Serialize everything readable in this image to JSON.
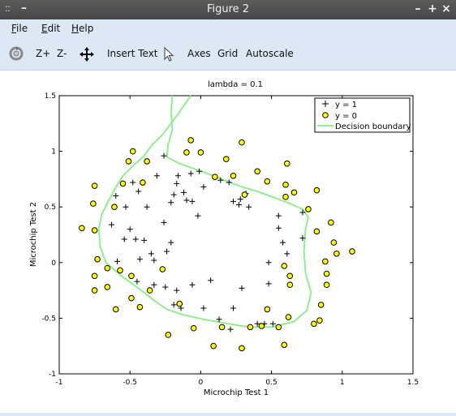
{
  "window": {
    "title": "Figure 2",
    "grip_glyph": "::",
    "left_min_glyph": "–",
    "min_glyph": "–",
    "max_glyph": "+",
    "close_glyph": "×"
  },
  "menu": {
    "items": [
      {
        "label": "File",
        "mnemonic": "F"
      },
      {
        "label": "Edit",
        "mnemonic": "E"
      },
      {
        "label": "Help",
        "mnemonic": "H"
      }
    ]
  },
  "toolbar": {
    "rotate_icon": "rotate-icon",
    "zoom_in": "Z+",
    "zoom_out": "Z-",
    "pan_icon": "pan-icon",
    "insert_text": "Insert Text",
    "select_icon": "pointer-icon",
    "axes": "Axes",
    "grid": "Grid",
    "autoscale": "Autoscale"
  },
  "colors": {
    "y1_marker": "#000000",
    "y0_fill": "#ffff00",
    "boundary": "#90ee90",
    "menu_bg": "#dce8f4"
  },
  "chart_data": {
    "type": "scatter",
    "title": "lambda = 0.1",
    "xlabel": "Microchip Test 1",
    "ylabel": "Microchip Test 2",
    "xlim": [
      -1,
      1.5
    ],
    "ylim": [
      -1,
      1.5
    ],
    "xticks": [
      -1,
      -0.5,
      0,
      0.5,
      1,
      1.5
    ],
    "yticks": [
      -1,
      -0.5,
      0,
      0.5,
      1,
      1.5
    ],
    "xtick_labels": [
      "-1",
      "-0.5",
      "0",
      "0.5",
      "1",
      "1.5"
    ],
    "ytick_labels": [
      "-1",
      "-0.5",
      "0",
      "0.5",
      "1",
      "1.5"
    ],
    "grid": false,
    "legend_position": "top-right",
    "series": [
      {
        "name": "y = 1",
        "marker": "plus",
        "points": [
          [
            -0.26,
            0.96
          ],
          [
            -0.31,
            0.78
          ],
          [
            -0.48,
            0.72
          ],
          [
            -0.6,
            0.6
          ],
          [
            -0.44,
            0.64
          ],
          [
            -0.38,
            0.5
          ],
          [
            -0.53,
            0.5
          ],
          [
            -0.63,
            0.34
          ],
          [
            -0.5,
            0.3
          ],
          [
            -0.4,
            0.2
          ],
          [
            -0.26,
            0.36
          ],
          [
            -0.54,
            0.21
          ],
          [
            -0.46,
            0.21
          ],
          [
            -0.35,
            0.08
          ],
          [
            -0.21,
            0.18
          ],
          [
            -0.24,
            0.1
          ],
          [
            -0.59,
            0.01
          ],
          [
            -0.43,
            0.03
          ],
          [
            -0.33,
            0.02
          ],
          [
            -0.45,
            -0.17
          ],
          [
            -0.33,
            -0.2
          ],
          [
            -0.25,
            -0.22
          ],
          [
            -0.17,
            -0.25
          ],
          [
            -0.06,
            -0.2
          ],
          [
            0.07,
            -0.16
          ],
          [
            0.29,
            -0.23
          ],
          [
            0.48,
            -0.19
          ],
          [
            -0.19,
            -0.38
          ],
          [
            -0.14,
            -0.41
          ],
          [
            0.02,
            -0.41
          ],
          [
            0.23,
            -0.41
          ],
          [
            0.13,
            -0.51
          ],
          [
            0.21,
            -0.6
          ],
          [
            0.4,
            -0.55
          ],
          [
            0.45,
            -0.55
          ],
          [
            0.51,
            -0.55
          ],
          [
            0.48,
            0.0
          ],
          [
            0.58,
            0.18
          ],
          [
            0.61,
            0.08
          ],
          [
            0.55,
            0.31
          ],
          [
            0.55,
            0.42
          ],
          [
            0.72,
            0.45
          ],
          [
            0.72,
            0.22
          ],
          [
            0.34,
            0.5
          ],
          [
            0.27,
            0.52
          ],
          [
            0.23,
            0.55
          ],
          [
            0.28,
            0.57
          ],
          [
            0.32,
            0.62
          ],
          [
            0.2,
            0.72
          ],
          [
            0.14,
            0.74
          ],
          [
            0.02,
            0.68
          ],
          [
            -0.01,
            0.82
          ],
          [
            -0.07,
            0.8
          ],
          [
            -0.16,
            0.78
          ],
          [
            -0.17,
            0.71
          ],
          [
            -0.12,
            0.63
          ],
          [
            -0.19,
            0.61
          ],
          [
            -0.1,
            0.56
          ],
          [
            -0.06,
            0.55
          ],
          [
            -0.21,
            0.54
          ],
          [
            -0.02,
            0.42
          ]
        ]
      },
      {
        "name": "y = 0",
        "marker": "circle",
        "points": [
          [
            -0.84,
            0.31
          ],
          [
            -0.75,
            0.69
          ],
          [
            -0.76,
            0.53
          ],
          [
            -0.75,
            0.29
          ],
          [
            -0.73,
            0.03
          ],
          [
            -0.75,
            -0.12
          ],
          [
            -0.75,
            -0.25
          ],
          [
            -0.66,
            -0.05
          ],
          [
            -0.66,
            -0.22
          ],
          [
            -0.6,
            -0.42
          ],
          [
            -0.57,
            -0.07
          ],
          [
            -0.49,
            -0.12
          ],
          [
            -0.49,
            -0.32
          ],
          [
            -0.43,
            -0.4
          ],
          [
            -0.36,
            -0.25
          ],
          [
            -0.27,
            -0.06
          ],
          [
            -0.23,
            -0.65
          ],
          [
            -0.15,
            -0.37
          ],
          [
            -0.05,
            -0.59
          ],
          [
            -0.61,
            0.5
          ],
          [
            -0.55,
            0.71
          ],
          [
            -0.51,
            0.91
          ],
          [
            -0.48,
            1.0
          ],
          [
            -0.41,
            0.72
          ],
          [
            -0.38,
            0.91
          ],
          [
            -0.1,
            0.99
          ],
          [
            -0.07,
            1.1
          ],
          [
            0.0,
            0.99
          ],
          [
            0.1,
            0.77
          ],
          [
            0.18,
            0.93
          ],
          [
            0.23,
            0.78
          ],
          [
            0.29,
            1.08
          ],
          [
            0.31,
            0.61
          ],
          [
            0.4,
            0.82
          ],
          [
            0.47,
            0.73
          ],
          [
            0.6,
            0.7
          ],
          [
            0.61,
            0.89
          ],
          [
            0.66,
            0.63
          ],
          [
            0.6,
            0.59
          ],
          [
            0.76,
            0.48
          ],
          [
            0.82,
            0.65
          ],
          [
            0.82,
            0.28
          ],
          [
            0.92,
            0.36
          ],
          [
            0.94,
            0.18
          ],
          [
            0.96,
            0.08
          ],
          [
            1.07,
            0.1
          ],
          [
            0.88,
            0.01
          ],
          [
            0.89,
            -0.1
          ],
          [
            0.59,
            -0.03
          ],
          [
            0.63,
            -0.12
          ],
          [
            0.63,
            -0.2
          ],
          [
            0.89,
            -0.2
          ],
          [
            0.85,
            -0.38
          ],
          [
            0.84,
            -0.52
          ],
          [
            0.8,
            -0.55
          ],
          [
            0.62,
            -0.49
          ],
          [
            0.55,
            -0.58
          ],
          [
            0.47,
            -0.42
          ],
          [
            0.43,
            -0.57
          ],
          [
            0.35,
            -0.58
          ],
          [
            0.29,
            -0.77
          ],
          [
            0.15,
            -0.58
          ],
          [
            0.09,
            -0.75
          ],
          [
            0.59,
            -0.74
          ]
        ]
      }
    ],
    "boundary": {
      "name": "Decision boundary",
      "segments": [
        [
          [
            -0.07,
            1.5
          ],
          [
            -0.18,
            1.3
          ],
          [
            -0.27,
            1.15
          ],
          [
            -0.35,
            1.05
          ],
          [
            -0.4,
            0.96
          ],
          [
            -0.47,
            0.88
          ],
          [
            -0.55,
            0.78
          ],
          [
            -0.6,
            0.68
          ],
          [
            -0.65,
            0.56
          ],
          [
            -0.7,
            0.43
          ],
          [
            -0.72,
            0.3
          ],
          [
            -0.71,
            0.14
          ],
          [
            -0.67,
            0.0
          ],
          [
            -0.56,
            -0.12
          ],
          [
            -0.44,
            -0.23
          ],
          [
            -0.33,
            -0.34
          ],
          [
            -0.24,
            -0.42
          ],
          [
            -0.12,
            -0.47
          ],
          [
            0.02,
            -0.51
          ],
          [
            0.2,
            -0.55
          ],
          [
            0.34,
            -0.58
          ],
          [
            0.5,
            -0.58
          ],
          [
            0.66,
            -0.53
          ],
          [
            0.75,
            -0.43
          ],
          [
            0.78,
            -0.27
          ],
          [
            0.74,
            -0.09
          ],
          [
            0.73,
            0.1
          ],
          [
            0.74,
            0.3
          ],
          [
            0.76,
            0.41
          ],
          [
            0.72,
            0.48
          ],
          [
            0.63,
            0.53
          ],
          [
            0.51,
            0.59
          ],
          [
            0.4,
            0.64
          ],
          [
            0.29,
            0.68
          ],
          [
            0.17,
            0.74
          ],
          [
            0.07,
            0.79
          ],
          [
            -0.06,
            0.85
          ],
          [
            -0.15,
            0.89
          ],
          [
            -0.24,
            0.95
          ],
          [
            -0.23,
            1.06
          ],
          [
            -0.2,
            1.2
          ],
          [
            -0.21,
            1.35
          ],
          [
            -0.2,
            1.5
          ]
        ]
      ]
    }
  }
}
